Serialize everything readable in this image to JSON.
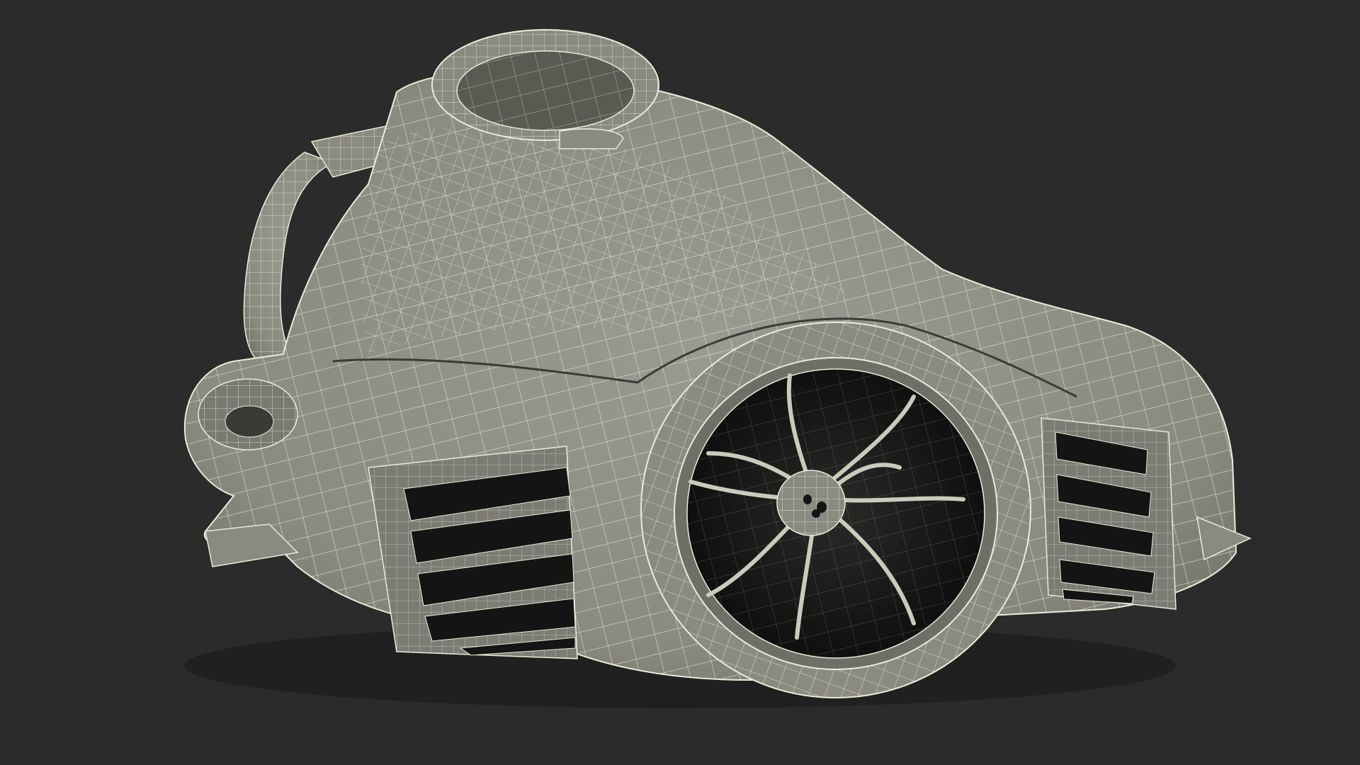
{
  "scene": {
    "background_color": "#2b2b2b",
    "shell_color": "#8f8f85",
    "shell_shadow_color": "#6d6d64",
    "wire_color": "#e9ecd8",
    "cavity_color": "#161616",
    "vent_slot_count_left": 5,
    "vent_slot_count_right": 5,
    "fan_blade_count": 9
  }
}
